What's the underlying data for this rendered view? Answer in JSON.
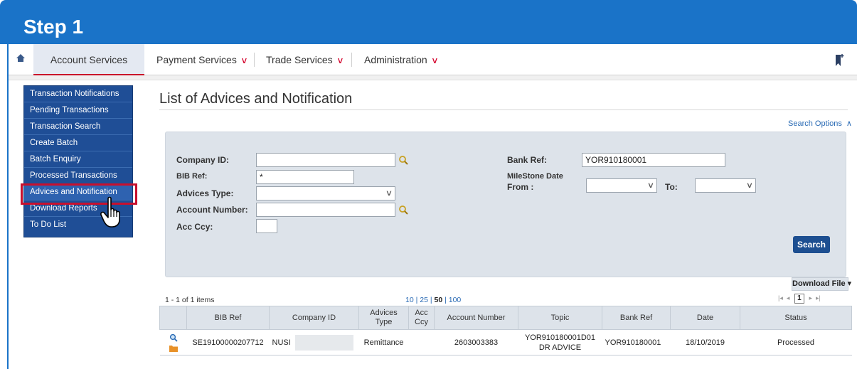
{
  "step": {
    "title": "Step 1"
  },
  "nav": {
    "items": [
      {
        "label": "Account Services"
      },
      {
        "label": "Payment Services"
      },
      {
        "label": "Trade Services"
      },
      {
        "label": "Administration"
      }
    ]
  },
  "sidebar": {
    "items": [
      {
        "label": "Transaction Notifications"
      },
      {
        "label": "Pending Transactions"
      },
      {
        "label": "Transaction Search"
      },
      {
        "label": "Create Batch"
      },
      {
        "label": "Batch Enquiry"
      },
      {
        "label": "Processed Transactions"
      },
      {
        "label": "Advices and Notification"
      },
      {
        "label": "Download Reports"
      },
      {
        "label": "To Do List"
      }
    ]
  },
  "page": {
    "title": "List of Advices and Notification",
    "search_options_label": "Search Options"
  },
  "search": {
    "company_id_label": "Company ID:",
    "company_id_value": "",
    "bib_ref_label": "BIB Ref:",
    "bib_ref_value": "*",
    "advices_type_label": "Advices Type:",
    "advices_type_value": "",
    "account_number_label": "Account Number:",
    "account_number_value": "",
    "acc_ccy_label": "Acc Ccy:",
    "acc_ccy_value": "",
    "bank_ref_label": "Bank Ref:",
    "bank_ref_value": "YOR910180001",
    "milestone_label": "MileStone Date",
    "from_label": "From :",
    "to_label": "To:",
    "search_button": "Search"
  },
  "grid": {
    "download_label": "Download File",
    "items_count": "1 - 1 of 1 items",
    "page_sizes": [
      "10",
      "25",
      "50",
      "100"
    ],
    "current_page_size": "50",
    "current_page": "1",
    "columns": [
      "BIB Ref",
      "Company ID",
      "Advices Type",
      "Acc Ccy",
      "Account Number",
      "Topic",
      "Bank Ref",
      "Date",
      "Status"
    ],
    "rows": [
      {
        "bib_ref": "SE19100000207712",
        "company_id": "NUSI",
        "advices_type": "Remittance",
        "acc_ccy": "",
        "account_number": "2603003383",
        "topic": "YOR910180001D01 DR ADVICE",
        "bank_ref": "YOR910180001",
        "date": "18/10/2019",
        "status": "Processed"
      }
    ]
  }
}
